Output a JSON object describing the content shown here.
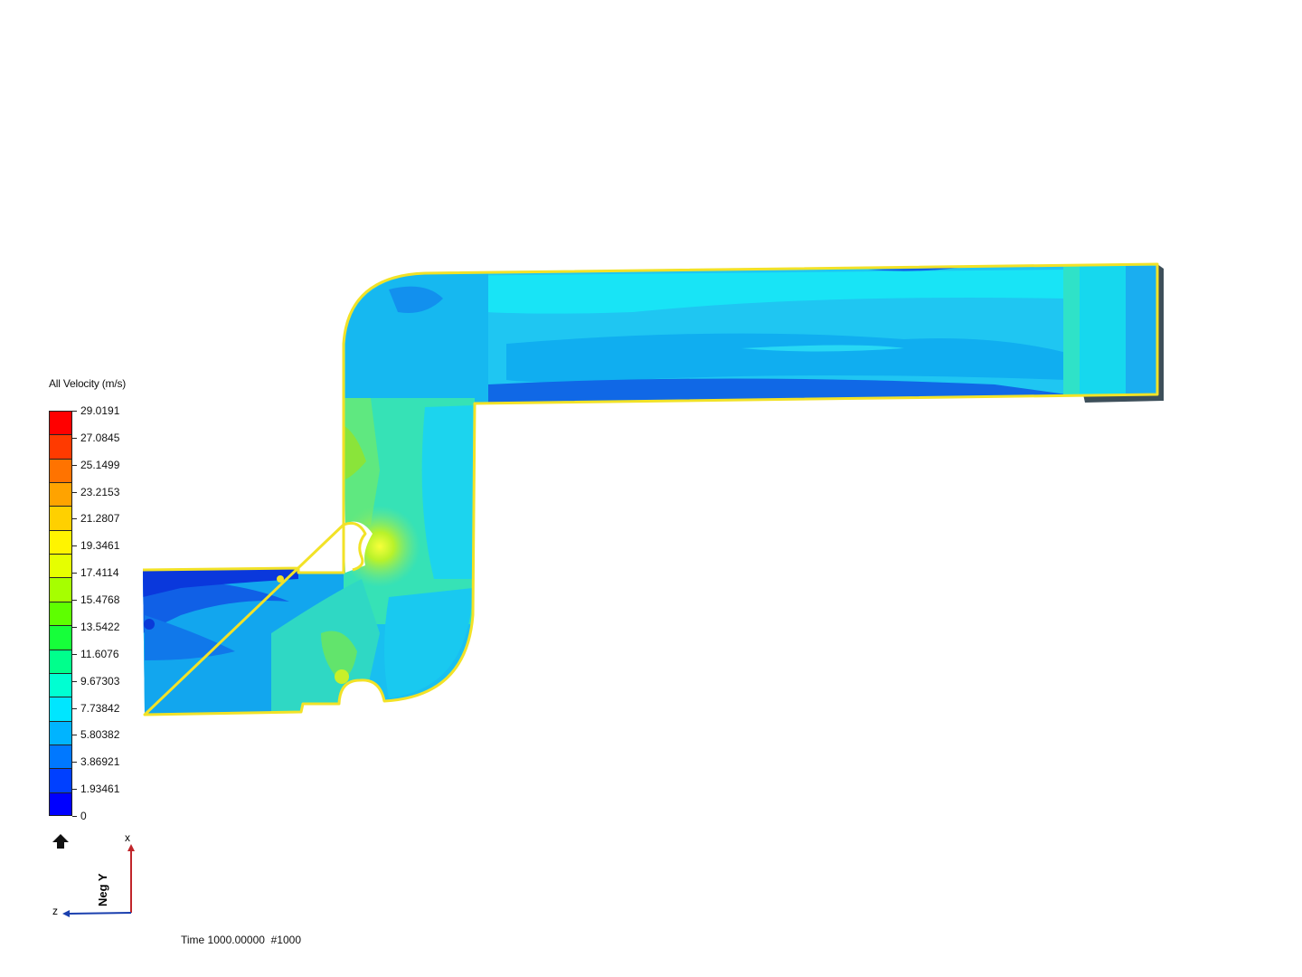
{
  "legend": {
    "title": "All Velocity (m/s)",
    "ticks": [
      "29.0191",
      "27.0845",
      "25.1499",
      "23.2153",
      "21.2807",
      "19.3461",
      "17.4114",
      "15.4768",
      "13.5422",
      "11.6076",
      "9.67303",
      "7.73842",
      "5.80382",
      "3.86921",
      "1.93461",
      "0"
    ],
    "band_colors": [
      "#ff0000",
      "#ff3a00",
      "#ff7300",
      "#ffa300",
      "#ffd000",
      "#fff400",
      "#e6ff00",
      "#a6ff00",
      "#5eff00",
      "#16ff3a",
      "#00ff8c",
      "#00ffd2",
      "#00e6ff",
      "#00b4ff",
      "#0078ff",
      "#0040ff",
      "#0000ff"
    ]
  },
  "triad": {
    "x_label": "x",
    "z_label": "z",
    "view_label": "Neg Y"
  },
  "time": {
    "text": "Time 1000.00000  #1000"
  },
  "colors": {
    "outline": "#f2e227",
    "low": "#1f4de0",
    "mid": "#14d2f2",
    "high": "#9ae630"
  }
}
